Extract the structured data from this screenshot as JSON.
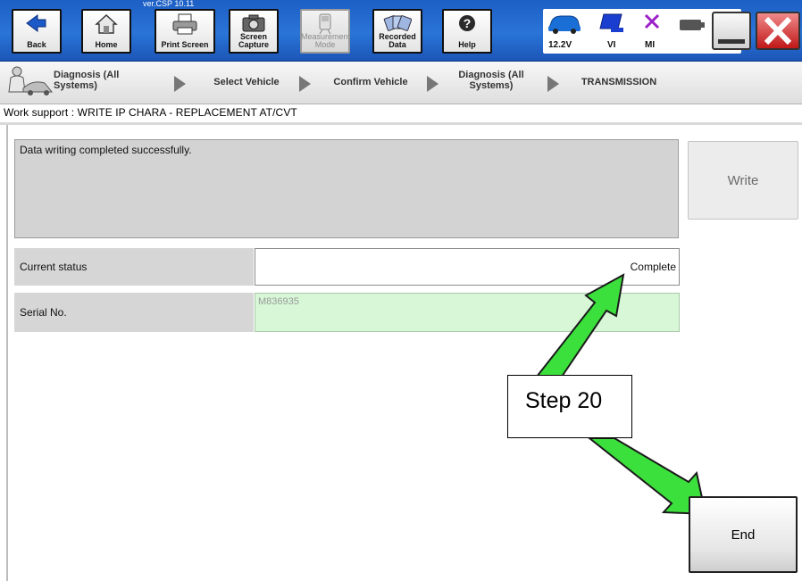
{
  "toolbar": {
    "version": "ver.CSP 10.11",
    "buttons": [
      {
        "label": "Back",
        "icon": "back-arrow-icon"
      },
      {
        "label": "Home",
        "icon": "home-icon"
      },
      {
        "label": "Print Screen",
        "icon": "printer-icon"
      },
      {
        "label": "Screen Capture",
        "icon": "camera-icon"
      },
      {
        "label": "Measurement Mode",
        "icon": "measurement-icon"
      },
      {
        "label": "Recorded Data",
        "icon": "recorded-data-icon"
      },
      {
        "label": "Help",
        "icon": "help-icon"
      }
    ],
    "status": {
      "battery_voltage": "12.2V",
      "vi_label": "VI",
      "mi_label": "MI"
    }
  },
  "breadcrumb": [
    "Diagnosis (All Systems)",
    "Select Vehicle",
    "Confirm Vehicle",
    "Diagnosis (All Systems)",
    "TRANSMISSION"
  ],
  "work_title": "Work support : WRITE IP CHARA - REPLACEMENT AT/CVT",
  "message": "Data writing completed successfully.",
  "write_label": "Write",
  "rows": {
    "status_label": "Current status",
    "status_value": "Complete",
    "serial_label": "Serial No.",
    "serial_value": "M836935"
  },
  "callout": "Step 20",
  "end_label": "End",
  "colors": {
    "toolbar_blue": "#2a74d8",
    "arrow_green": "#3ce03c",
    "close_red": "#c01818"
  }
}
